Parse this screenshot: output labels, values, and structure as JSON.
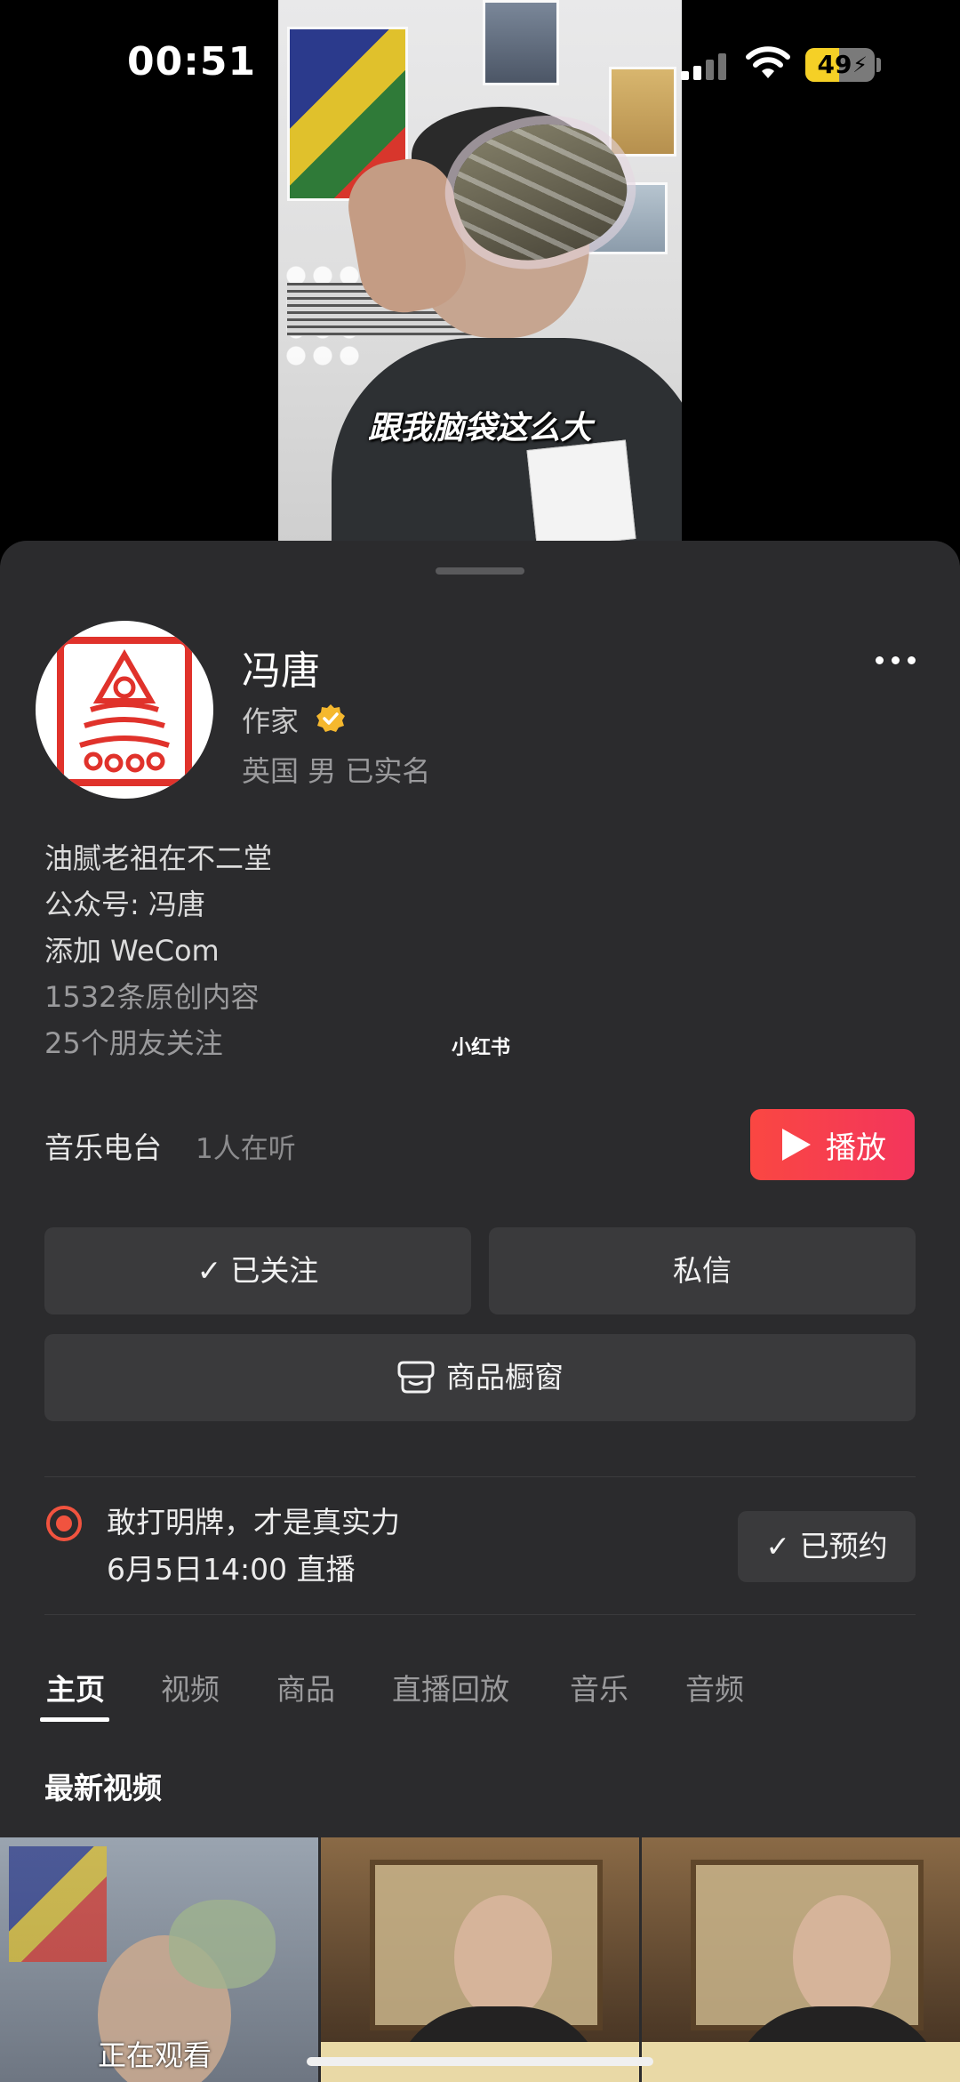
{
  "status_bar": {
    "time": "00:51",
    "battery": "49"
  },
  "video": {
    "subtitle": "跟我脑袋这么大"
  },
  "profile": {
    "name": "冯唐",
    "role": "作家",
    "meta": "英国 男 已实名",
    "bio_lines": [
      "油腻老祖在不二堂",
      "公众号: 冯唐",
      "添加 WeCom"
    ],
    "original_content": "1532条原创内容",
    "friends_following": "25个朋友关注",
    "watermark": "小红书"
  },
  "radio": {
    "label": "音乐电台",
    "listeners": "1人在听",
    "play_label": "播放"
  },
  "actions": {
    "followed_label": "已关注",
    "message_label": "私信",
    "shop_label": "商品橱窗"
  },
  "live": {
    "title": "敢打明牌，才是真实力",
    "date": "6月5日14:00 直播",
    "reserved_label": "已预约"
  },
  "tabs": [
    "主页",
    "视频",
    "商品",
    "直播回放",
    "音乐",
    "音频"
  ],
  "latest": {
    "section_title": "最新视频",
    "watching_label": "正在观看"
  },
  "colors": {
    "accent_red": "#f3355c",
    "live_orange": "#f1533f",
    "verified_gold": "#f5b82e",
    "sheet_bg": "#2b2b2d"
  },
  "icons": [
    "signal-icon",
    "wifi-icon",
    "battery-icon",
    "more-icon",
    "verified-icon",
    "play-icon",
    "check-icon",
    "shop-icon",
    "live-icon"
  ]
}
